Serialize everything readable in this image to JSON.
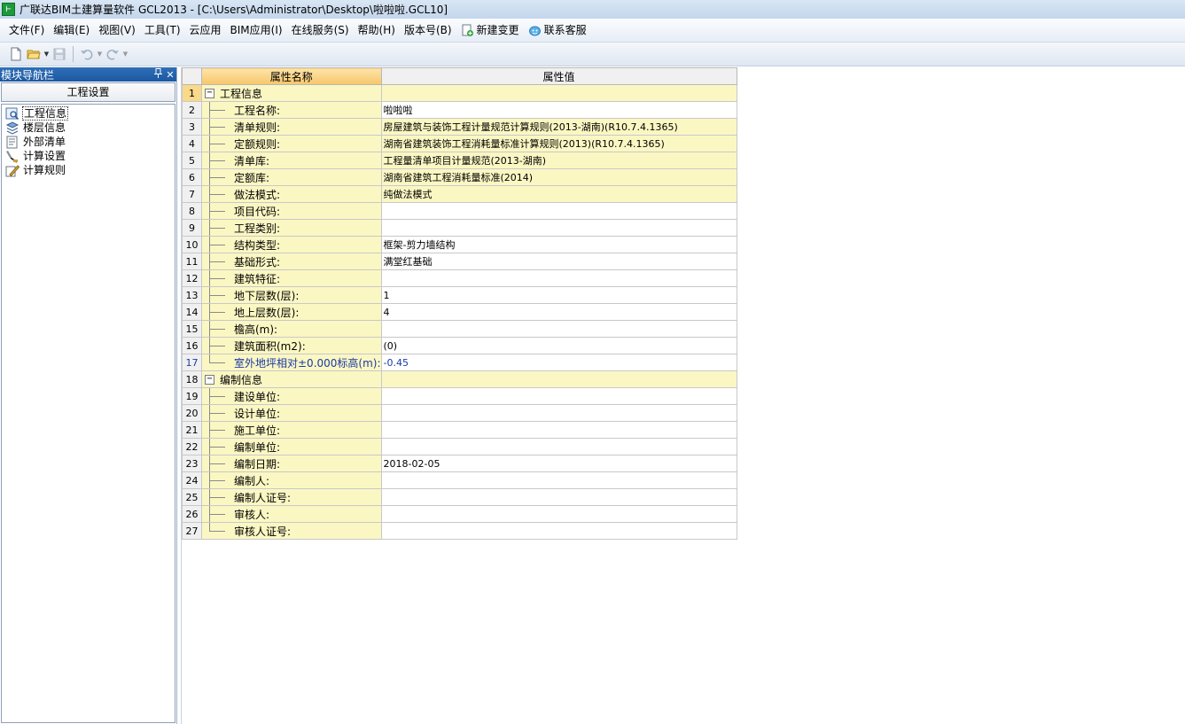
{
  "window": {
    "title": "广联达BIM土建算量软件 GCL2013 - [C:\\Users\\Administrator\\Desktop\\啦啦啦.GCL10]",
    "app_icon_glyph": "⊢"
  },
  "menu": {
    "items": [
      "文件(F)",
      "编辑(E)",
      "视图(V)",
      "工具(T)",
      "云应用",
      "BIM应用(I)",
      "在线服务(S)",
      "帮助(H)",
      "版本号(B)"
    ],
    "new_change": "新建变更",
    "contact_service": "联系客服"
  },
  "nav": {
    "title": "模块导航栏",
    "pin": "ꟷ",
    "close": "✕",
    "group": "工程设置",
    "items": [
      {
        "label": "工程信息",
        "icon": "project-info-icon"
      },
      {
        "label": "楼层信息",
        "icon": "floor-info-icon"
      },
      {
        "label": "外部清单",
        "icon": "external-list-icon"
      },
      {
        "label": "计算设置",
        "icon": "calc-settings-icon"
      },
      {
        "label": "计算规则",
        "icon": "calc-rules-icon"
      }
    ]
  },
  "grid": {
    "headers": {
      "name": "属性名称",
      "value": "属性值"
    },
    "rows": [
      {
        "n": "1",
        "name": "工程信息",
        "value": "",
        "kind": "group"
      },
      {
        "n": "2",
        "name": "工程名称:",
        "value": "啦啦啦",
        "kind": "white"
      },
      {
        "n": "3",
        "name": "清单规则:",
        "value": "房屋建筑与装饰工程计量规范计算规则(2013-湖南)(R10.7.4.1365)",
        "kind": "yellow"
      },
      {
        "n": "4",
        "name": "定额规则:",
        "value": "湖南省建筑装饰工程消耗量标准计算规则(2013)(R10.7.4.1365)",
        "kind": "yellow"
      },
      {
        "n": "5",
        "name": "清单库:",
        "value": "工程量清单项目计量规范(2013-湖南)",
        "kind": "yellow"
      },
      {
        "n": "6",
        "name": "定额库:",
        "value": "湖南省建筑工程消耗量标准(2014)",
        "kind": "yellow"
      },
      {
        "n": "7",
        "name": "做法模式:",
        "value": "纯做法模式",
        "kind": "yellow"
      },
      {
        "n": "8",
        "name": "项目代码:",
        "value": "",
        "kind": "white"
      },
      {
        "n": "9",
        "name": "工程类别:",
        "value": "",
        "kind": "white"
      },
      {
        "n": "10",
        "name": "结构类型:",
        "value": "框架-剪力墙结构",
        "kind": "white"
      },
      {
        "n": "11",
        "name": "基础形式:",
        "value": "满堂红基础",
        "kind": "white"
      },
      {
        "n": "12",
        "name": "建筑特征:",
        "value": "",
        "kind": "white"
      },
      {
        "n": "13",
        "name": "地下层数(层):",
        "value": "1",
        "kind": "white"
      },
      {
        "n": "14",
        "name": "地上层数(层):",
        "value": "4",
        "kind": "white"
      },
      {
        "n": "15",
        "name": "檐高(m):",
        "value": "",
        "kind": "white"
      },
      {
        "n": "16",
        "name": "建筑面积(m2):",
        "value": "(0)",
        "kind": "white"
      },
      {
        "n": "17",
        "name": "室外地坪相对±0.000标高(m):",
        "value": "-0.45",
        "kind": "blue",
        "last": true
      },
      {
        "n": "18",
        "name": "编制信息",
        "value": "",
        "kind": "group"
      },
      {
        "n": "19",
        "name": "建设单位:",
        "value": "",
        "kind": "white"
      },
      {
        "n": "20",
        "name": "设计单位:",
        "value": "",
        "kind": "white"
      },
      {
        "n": "21",
        "name": "施工单位:",
        "value": "",
        "kind": "white"
      },
      {
        "n": "22",
        "name": "编制单位:",
        "value": "",
        "kind": "white"
      },
      {
        "n": "23",
        "name": "编制日期:",
        "value": "2018-02-05",
        "kind": "white"
      },
      {
        "n": "24",
        "name": "编制人:",
        "value": "",
        "kind": "white"
      },
      {
        "n": "25",
        "name": "编制人证号:",
        "value": "",
        "kind": "white"
      },
      {
        "n": "26",
        "name": "审核人:",
        "value": "",
        "kind": "white"
      },
      {
        "n": "27",
        "name": "审核人证号:",
        "value": "",
        "kind": "white",
        "last": true
      }
    ]
  },
  "colors": {
    "cell_yellow": "#fbf7c3",
    "header_orange": "#f7c66a",
    "nav_blue": "#1c58a2",
    "blue_text": "#1a3aa8"
  }
}
